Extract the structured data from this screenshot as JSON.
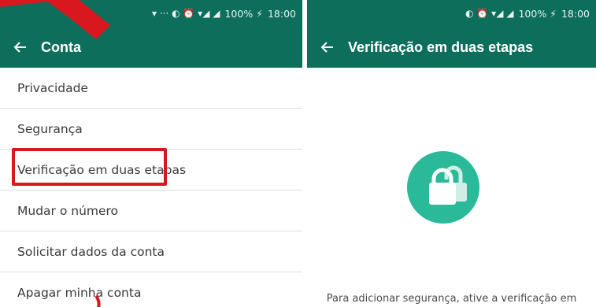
{
  "colors": {
    "appbar": "#0c6e5b",
    "accent": "#2aba9a",
    "highlight": "#d8181e"
  },
  "left": {
    "status": {
      "icons": "▾ ··· ◐ ⏰ ▾◢ ◢",
      "battery": "100% ⚡",
      "time": "18:00"
    },
    "appbar": {
      "title": "Conta",
      "back_icon": "arrow-left-icon"
    },
    "items": [
      {
        "label": "Privacidade"
      },
      {
        "label": "Segurança"
      },
      {
        "label": "Verificação em duas etapas"
      },
      {
        "label": "Mudar o número"
      },
      {
        "label": "Solicitar dados da conta"
      },
      {
        "label": "Apagar minha conta"
      }
    ]
  },
  "right": {
    "status": {
      "icons": "◐ ⏰ ▾◢ ◢",
      "battery": "100% ⚡",
      "time": "18:00"
    },
    "appbar": {
      "title": "Verificação em duas etapas",
      "back_icon": "arrow-left-icon"
    },
    "illustration_icon": "lock-icon",
    "description": "Para adicionar segurança, ative a verificação em"
  }
}
